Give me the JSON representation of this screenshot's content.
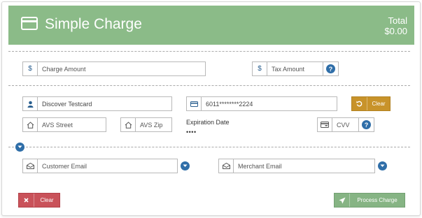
{
  "header": {
    "title": "Simple Charge",
    "total_label": "Total",
    "total_value": "$0.00"
  },
  "amounts": {
    "charge_amount_placeholder": "Charge Amount",
    "tax_amount_placeholder": "Tax Amount",
    "currency_symbol": "$"
  },
  "card": {
    "cardholder_name": "Discover Testcard",
    "card_number": "6011********2224",
    "clear_label": "Clear",
    "avs_street_placeholder": "AVS Street",
    "avs_zip_placeholder": "AVS Zip",
    "expiration_label": "Expiration Date",
    "expiration_value": "••••",
    "cvv_placeholder": "CVV"
  },
  "emails": {
    "customer_email_placeholder": "Customer Email",
    "merchant_email_placeholder": "Merchant Email"
  },
  "actions": {
    "clear_label": "Clear",
    "process_label": "Process Charge"
  },
  "help_glyph": "?",
  "colors": {
    "header_bg": "#8bbb88",
    "accent_blue": "#2f6ea8",
    "clear_card_btn": "#c8932a",
    "clear_form_btn": "#c9525a",
    "process_btn": "#86b484"
  }
}
